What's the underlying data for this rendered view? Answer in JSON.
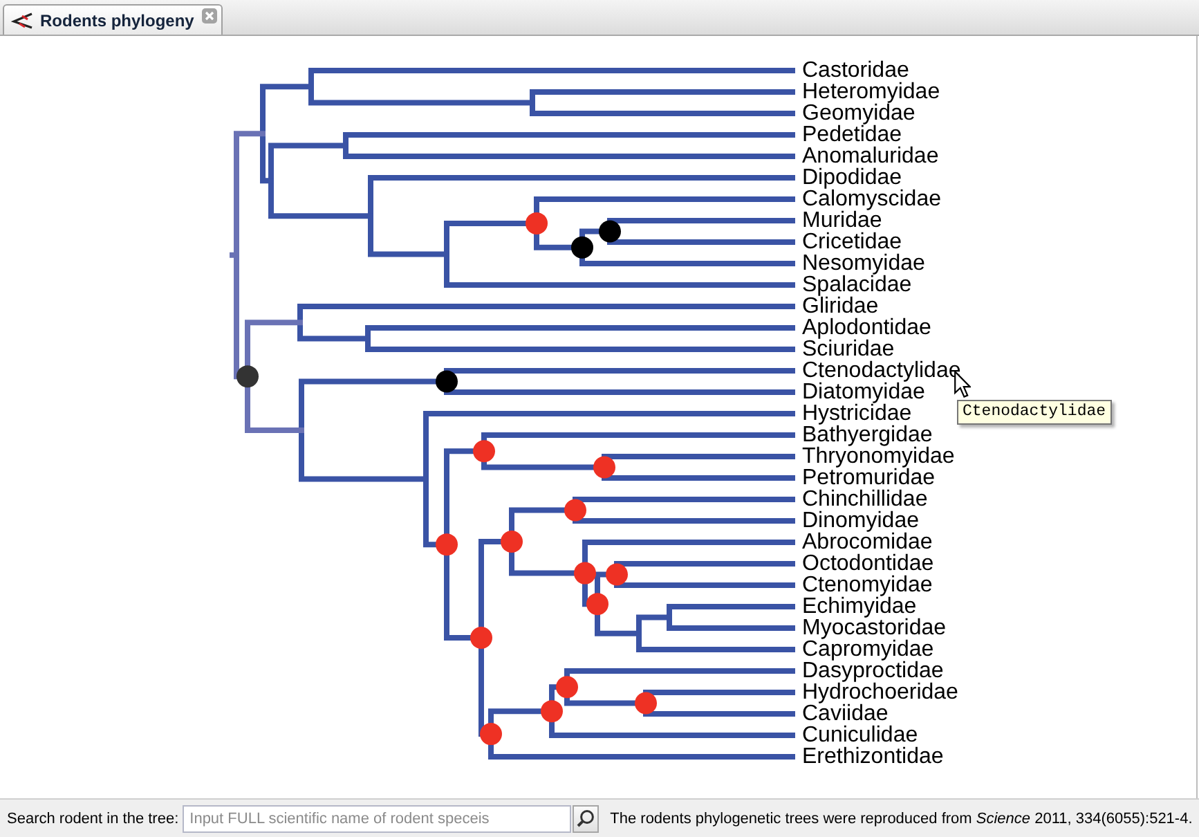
{
  "tab": {
    "title": "Rodents phylogeny",
    "selected": true
  },
  "tree": {
    "children": [
      {
        "children": [
          {
            "children": [
              {
                "name": "Castoridae"
              },
              {
                "children": [
                  {
                    "name": "Heteromyidae"
                  },
                  {
                    "name": "Geomyidae"
                  }
                ]
              }
            ]
          },
          {
            "children": [
              {
                "children": [
                  {
                    "name": "Pedetidae"
                  },
                  {
                    "name": "Anomaluridae"
                  }
                ]
              },
              {
                "children": [
                  {
                    "name": "Dipodidae"
                  },
                  {
                    "children": [
                      {
                        "color": "#ee3124",
                        "children": [
                          {
                            "name": "Calomyscidae"
                          },
                          {
                            "color": "#000000",
                            "children": [
                              {
                                "color": "#000000",
                                "children": [
                                  {
                                    "name": "Muridae"
                                  },
                                  {
                                    "name": "Cricetidae"
                                  }
                                ]
                              },
                              {
                                "name": "Nesomyidae"
                              }
                            ]
                          }
                        ]
                      },
                      {
                        "name": "Spalacidae"
                      }
                    ]
                  }
                ]
              }
            ]
          }
        ]
      },
      {
        "color": "#333333",
        "children": [
          {
            "children": [
              {
                "name": "Gliridae"
              },
              {
                "children": [
                  {
                    "name": "Aplodontidae"
                  },
                  {
                    "name": "Sciuridae"
                  }
                ]
              }
            ]
          },
          {
            "children": [
              {
                "color": "#000000",
                "children": [
                  {
                    "name": "Ctenodactylidae"
                  },
                  {
                    "name": "Diatomyidae"
                  }
                ]
              },
              {
                "children": [
                  {
                    "name": "Hystricidae"
                  },
                  {
                    "color": "#ee3124",
                    "children": [
                      {
                        "color": "#ee3124",
                        "children": [
                          {
                            "name": "Bathyergidae"
                          },
                          {
                            "color": "#ee3124",
                            "children": [
                              {
                                "name": "Thryonomyidae"
                              },
                              {
                                "name": "Petromuridae"
                              }
                            ]
                          }
                        ]
                      },
                      {
                        "color": "#ee3124",
                        "children": [
                          {
                            "color": "#ee3124",
                            "children": [
                              {
                                "color": "#ee3124",
                                "children": [
                                  {
                                    "name": "Chinchillidae"
                                  },
                                  {
                                    "name": "Dinomyidae"
                                  }
                                ]
                              },
                              {
                                "color": "#ee3124",
                                "children": [
                                  {
                                    "name": "Abrocomidae"
                                  },
                                  {
                                    "color": "#ee3124",
                                    "children": [
                                      {
                                        "color": "#ee3124",
                                        "children": [
                                          {
                                            "name": "Octodontidae"
                                          },
                                          {
                                            "name": "Ctenomyidae"
                                          }
                                        ]
                                      },
                                      {
                                        "children": [
                                          {
                                            "children": [
                                              {
                                                "name": "Echimyidae"
                                              },
                                              {
                                                "name": "Myocastoridae"
                                              }
                                            ]
                                          },
                                          {
                                            "name": "Capromyidae"
                                          }
                                        ]
                                      }
                                    ]
                                  }
                                ]
                              }
                            ]
                          },
                          {
                            "color": "#ee3124",
                            "children": [
                              {
                                "color": "#ee3124",
                                "children": [
                                  {
                                    "color": "#ee3124",
                                    "children": [
                                      {
                                        "name": "Dasyproctidae"
                                      },
                                      {
                                        "color": "#ee3124",
                                        "children": [
                                          {
                                            "name": "Hydrochoeridae"
                                          },
                                          {
                                            "name": "Caviidae"
                                          }
                                        ]
                                      }
                                    ]
                                  },
                                  {
                                    "name": "Cuniculidae"
                                  }
                                ]
                              },
                              {
                                "name": "Erethizontidae"
                              }
                            ]
                          }
                        ]
                      }
                    ]
                  }
                ]
              }
            ]
          }
        ]
      }
    ]
  },
  "tooltip": {
    "text": "Ctenodactylidae"
  },
  "search": {
    "label": "Search rodent in the tree:",
    "placeholder": "Input FULL scientific name of rodent speceis"
  },
  "citation": "The rodents phylogenetic trees were reproduced from *Science* 2011, 334(6055):521-4."
}
